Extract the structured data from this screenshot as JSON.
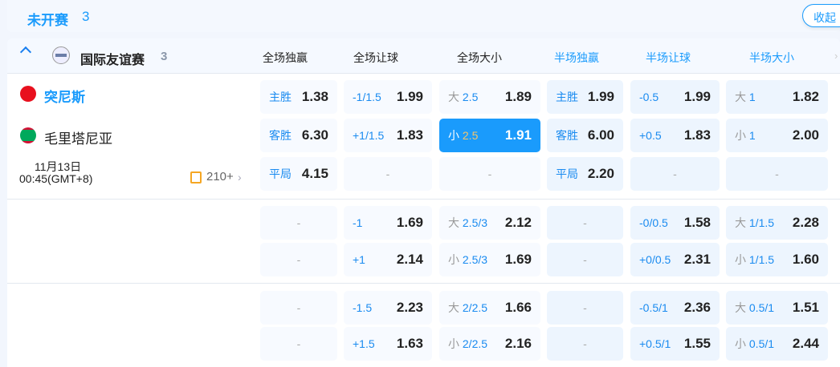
{
  "section": {
    "title": "未开赛",
    "count": "3",
    "collapse_label": "收起"
  },
  "league": {
    "name": "国际友谊赛",
    "count": "3",
    "columns": [
      "全场独赢",
      "全场让球",
      "全场大小",
      "半场独赢",
      "半场让球",
      "半场大小"
    ]
  },
  "colors": {
    "accent": "#1a9bfc",
    "selected": "#1a9bfc"
  },
  "match": {
    "home": "突尼斯",
    "away": "毛里塔尼亚",
    "date": "11月13日",
    "time": "00:45(GMT+8)",
    "markets_count": "210+"
  },
  "rows": [
    [
      [
        {
          "w": "主胜",
          "n": "",
          "o": "1.38"
        },
        {
          "w": "",
          "n": "-1/1.5",
          "o": "1.99"
        },
        {
          "w": "大",
          "n": "2.5",
          "o": "1.89"
        },
        {
          "w": "主胜",
          "n": "",
          "o": "1.99"
        },
        {
          "w": "",
          "n": "-0.5",
          "o": "1.99"
        },
        {
          "w": "大",
          "n": "1",
          "o": "1.82"
        }
      ],
      [
        {
          "w": "客胜",
          "n": "",
          "o": "6.30"
        },
        {
          "w": "",
          "n": "+1/1.5",
          "o": "1.83"
        },
        {
          "w": "小",
          "n": "2.5",
          "o": "1.91",
          "sel": true
        },
        {
          "w": "客胜",
          "n": "",
          "o": "6.00"
        },
        {
          "w": "",
          "n": "+0.5",
          "o": "1.83"
        },
        {
          "w": "小",
          "n": "1",
          "o": "2.00"
        }
      ],
      [
        {
          "w": "平局",
          "n": "",
          "o": "4.15"
        },
        {
          "e": "-"
        },
        {
          "e": "-"
        },
        {
          "w": "平局",
          "n": "",
          "o": "2.20"
        },
        {
          "e": "-"
        },
        {
          "e": "-"
        }
      ]
    ],
    [
      [
        {
          "e": "-"
        },
        {
          "w": "",
          "n": "-1",
          "o": "1.69"
        },
        {
          "w": "大",
          "n": "2.5/3",
          "o": "2.12"
        },
        {
          "e": "-"
        },
        {
          "w": "",
          "n": "-0/0.5",
          "o": "1.58"
        },
        {
          "w": "大",
          "n": "1/1.5",
          "o": "2.28"
        }
      ],
      [
        {
          "e": "-"
        },
        {
          "w": "",
          "n": "+1",
          "o": "2.14"
        },
        {
          "w": "小",
          "n": "2.5/3",
          "o": "1.69"
        },
        {
          "e": "-"
        },
        {
          "w": "",
          "n": "+0/0.5",
          "o": "2.31"
        },
        {
          "w": "小",
          "n": "1/1.5",
          "o": "1.60"
        }
      ]
    ],
    [
      [
        {
          "e": "-"
        },
        {
          "w": "",
          "n": "-1.5",
          "o": "2.23"
        },
        {
          "w": "大",
          "n": "2/2.5",
          "o": "1.66"
        },
        {
          "e": "-"
        },
        {
          "w": "",
          "n": "-0.5/1",
          "o": "2.36"
        },
        {
          "w": "大",
          "n": "0.5/1",
          "o": "1.51"
        }
      ],
      [
        {
          "e": "-"
        },
        {
          "w": "",
          "n": "+1.5",
          "o": "1.63"
        },
        {
          "w": "小",
          "n": "2/2.5",
          "o": "2.16"
        },
        {
          "e": "-"
        },
        {
          "w": "",
          "n": "+0.5/1",
          "o": "1.55"
        },
        {
          "w": "小",
          "n": "0.5/1",
          "o": "2.44"
        }
      ]
    ]
  ]
}
